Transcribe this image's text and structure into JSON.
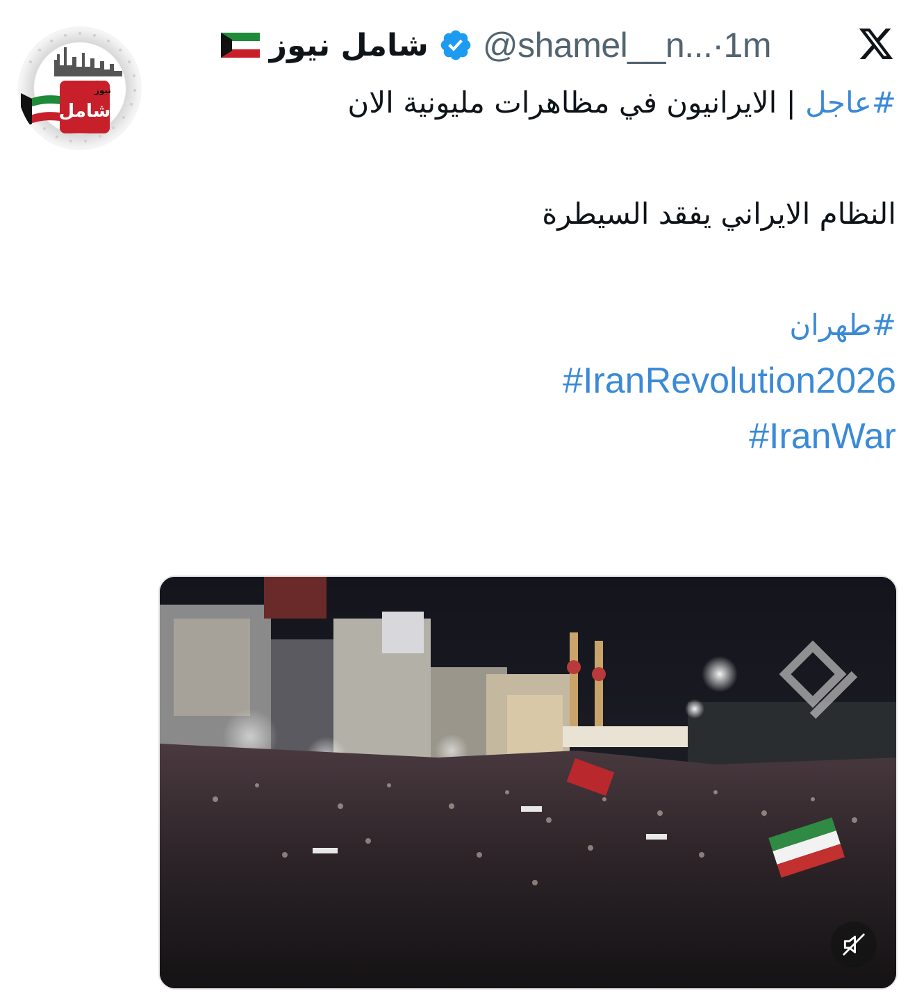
{
  "post": {
    "display_name": "شامل نيوز",
    "handle": "@shamel__n...",
    "separator": "·",
    "time": "1m",
    "lines": [
      {
        "hashtag": "#عاجل",
        "text": " | الايرانيون في مظاهرات مليونية الان"
      },
      {
        "text": "النظام الايراني يفقد السيطرة"
      }
    ],
    "hashtags": [
      "#طهران",
      "#IranRevolution2026",
      "#IranWar"
    ]
  },
  "avatar": {
    "logo_text": "شامل",
    "logo_subtext": "نيوز"
  },
  "icons": {
    "platform": "x-logo-icon",
    "verified": "verified-badge-icon",
    "flag": "kuwait-flag-icon",
    "mute": "muted-speaker-icon"
  },
  "colors": {
    "hashtag": "#3b8ad6",
    "verified": "#1d9bf0",
    "secondary_text": "#536471"
  }
}
